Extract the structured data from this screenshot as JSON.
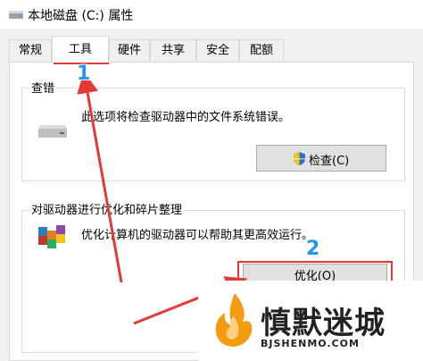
{
  "window": {
    "title": "本地磁盘 (C:) 属性"
  },
  "tabs": [
    {
      "label": "常规"
    },
    {
      "label": "工具"
    },
    {
      "label": "硬件"
    },
    {
      "label": "共享"
    },
    {
      "label": "安全"
    },
    {
      "label": "配额"
    }
  ],
  "error_check": {
    "group_title": "查错",
    "description": "此选项将检查驱动器中的文件系统错误。",
    "button_label": "检查(C)"
  },
  "optimize": {
    "group_title": "对驱动器进行优化和碎片整理",
    "description": "优化计算机的驱动器可以帮助其更高效运行。",
    "button_label": "优化(O)"
  },
  "annotations": {
    "step1": "1",
    "step2": "2",
    "color": "#e53935",
    "badge_color": "#2196f3"
  },
  "watermark": {
    "text": "慎默迷城",
    "subtext": "BJSHENMO.COM"
  }
}
